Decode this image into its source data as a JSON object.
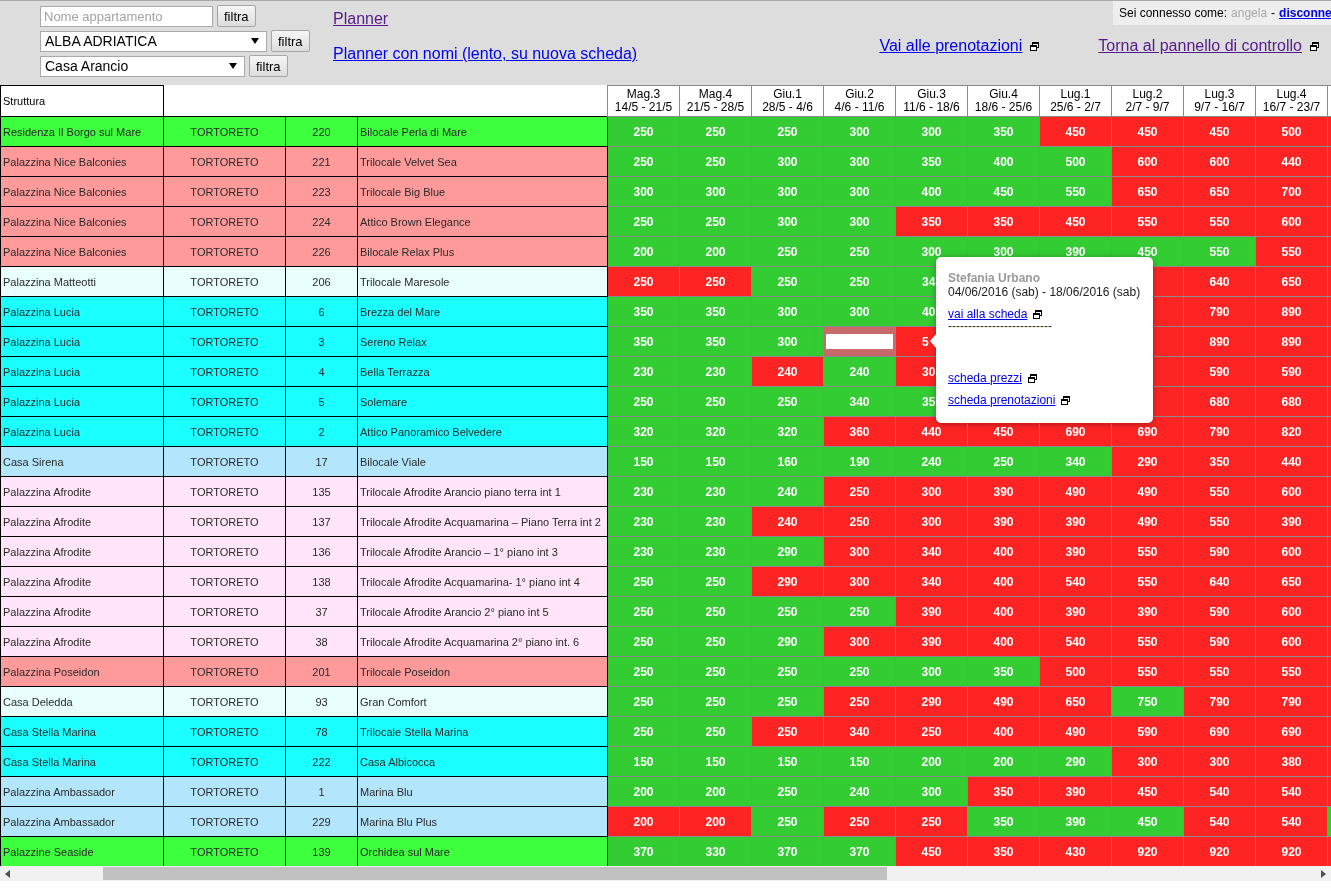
{
  "filters": {
    "search": {
      "placeholder": "Nome appartamento",
      "button": "filtra"
    },
    "selects": [
      {
        "value": "ALBA ADRIATICA",
        "button": "filtra"
      },
      {
        "value": "Casa Arancio",
        "button": "filtra"
      }
    ]
  },
  "planner_links": [
    {
      "label": "Planner",
      "visited": true
    },
    {
      "label": "Planner con nomi (lento, su nuova scheda)",
      "visited": false
    }
  ],
  "user": {
    "label": "Sei connesso come:",
    "name": "angela",
    "separator": "-",
    "logout": "disconne"
  },
  "nav_links": [
    {
      "label": "Vai alle prenotazioni",
      "visited": false
    },
    {
      "label": "Torna al pannello di controllo",
      "visited": true
    }
  ],
  "table": {
    "first_column": "Struttura",
    "weeks": [
      {
        "name": "Mag.3",
        "range": "14/5 - 21/5"
      },
      {
        "name": "Mag.4",
        "range": "21/5 - 28/5"
      },
      {
        "name": "Giu.1",
        "range": "28/5 - 4/6"
      },
      {
        "name": "Giu.2",
        "range": "4/6 - 11/6"
      },
      {
        "name": "Giu.3",
        "range": "11/6 - 18/6"
      },
      {
        "name": "Giu.4",
        "range": "18/6 - 25/6"
      },
      {
        "name": "Lug.1",
        "range": "25/6 - 2/7"
      },
      {
        "name": "Lug.2",
        "range": "2/7 - 9/7"
      },
      {
        "name": "Lug.3",
        "range": "9/7 - 16/7"
      },
      {
        "name": "Lug.4",
        "range": "16/7 - 23/7"
      }
    ],
    "rows": [
      {
        "struttura": "Residenza Il Borgo sul Mare",
        "town": "TORTORETO",
        "number": "220",
        "apartment": "Bilocale Perla di Mare",
        "color": "#3dff3d",
        "cells": [
          {
            "kind": "price",
            "price": "250",
            "booked": false
          },
          {
            "kind": "price",
            "price": "250",
            "booked": false
          },
          {
            "kind": "price",
            "price": "250",
            "booked": false
          },
          {
            "kind": "price",
            "price": "300",
            "booked": false
          },
          {
            "kind": "price",
            "price": "300",
            "booked": false
          },
          {
            "kind": "price",
            "price": "350",
            "booked": false
          },
          {
            "kind": "price",
            "price": "450",
            "booked": true
          },
          {
            "kind": "price",
            "price": "450",
            "booked": true
          },
          {
            "kind": "price",
            "price": "450",
            "booked": true
          },
          {
            "kind": "price",
            "price": "500",
            "booked": true
          },
          {
            "kind": "price",
            "booked": true
          }
        ]
      },
      {
        "struttura": "Palazzina Nice Balconies",
        "town": "TORTORETO",
        "number": "221",
        "apartment": "Trilocale Velvet Sea",
        "color": "#ff9a9a",
        "cells": [
          {
            "kind": "price",
            "price": "250",
            "booked": false
          },
          {
            "kind": "price",
            "price": "250",
            "booked": false
          },
          {
            "kind": "price",
            "price": "300",
            "booked": false
          },
          {
            "kind": "price",
            "price": "300",
            "booked": false
          },
          {
            "kind": "price",
            "price": "350",
            "booked": false
          },
          {
            "kind": "price",
            "price": "400",
            "booked": false
          },
          {
            "kind": "price",
            "price": "500",
            "booked": false
          },
          {
            "kind": "price",
            "price": "600",
            "booked": true
          },
          {
            "kind": "price",
            "price": "600",
            "booked": true
          },
          {
            "kind": "price",
            "price": "440",
            "booked": true
          },
          {
            "kind": "price",
            "booked": true
          }
        ]
      },
      {
        "struttura": "Palazzina Nice Balconies",
        "town": "TORTORETO",
        "number": "223",
        "apartment": "Trilocale Big Blue",
        "color": "#ff9a9a",
        "cells": [
          {
            "kind": "price",
            "price": "300",
            "booked": false
          },
          {
            "kind": "price",
            "price": "300",
            "booked": false
          },
          {
            "kind": "price",
            "price": "300",
            "booked": false
          },
          {
            "kind": "price",
            "price": "300",
            "booked": false
          },
          {
            "kind": "price",
            "price": "400",
            "booked": false
          },
          {
            "kind": "price",
            "price": "450",
            "booked": false
          },
          {
            "kind": "price",
            "price": "550",
            "booked": false
          },
          {
            "kind": "price",
            "price": "650",
            "booked": true
          },
          {
            "kind": "price",
            "price": "650",
            "booked": true
          },
          {
            "kind": "price",
            "price": "700",
            "booked": true
          },
          {
            "kind": "price",
            "booked": true
          }
        ]
      },
      {
        "struttura": "Palazzina Nice Balconies",
        "town": "TORTORETO",
        "number": "224",
        "apartment": "Attico Brown Elegance",
        "color": "#ff9a9a",
        "cells": [
          {
            "kind": "price",
            "price": "250",
            "booked": false
          },
          {
            "kind": "price",
            "price": "250",
            "booked": false
          },
          {
            "kind": "price",
            "price": "300",
            "booked": false
          },
          {
            "kind": "price",
            "price": "300",
            "booked": false
          },
          {
            "kind": "price",
            "price": "350",
            "booked": true
          },
          {
            "kind": "price",
            "price": "350",
            "booked": true
          },
          {
            "kind": "price",
            "price": "450",
            "booked": true
          },
          {
            "kind": "price",
            "price": "550",
            "booked": true
          },
          {
            "kind": "price",
            "price": "550",
            "booked": true
          },
          {
            "kind": "price",
            "price": "600",
            "booked": true
          },
          {
            "kind": "price",
            "booked": true
          }
        ]
      },
      {
        "struttura": "Palazzina Nice Balconies",
        "town": "TORTORETO",
        "number": "226",
        "apartment": "Bilocale Relax Plus",
        "color": "#ff9a9a",
        "cells": [
          {
            "kind": "price",
            "price": "200",
            "booked": false
          },
          {
            "kind": "price",
            "price": "200",
            "booked": false
          },
          {
            "kind": "price",
            "price": "250",
            "booked": false
          },
          {
            "kind": "price",
            "price": "250",
            "booked": false
          },
          {
            "kind": "price",
            "price": "300",
            "booked": false
          },
          {
            "kind": "price",
            "price": "300",
            "booked": false
          },
          {
            "kind": "price",
            "price": "390",
            "booked": false
          },
          {
            "kind": "price",
            "price": "450",
            "booked": false
          },
          {
            "kind": "price",
            "price": "550",
            "booked": false
          },
          {
            "kind": "price",
            "price": "550",
            "booked": true
          },
          {
            "kind": "price",
            "booked": true
          }
        ]
      },
      {
        "struttura": "Palazzina Matteotti",
        "town": "TORTORETO",
        "number": "206",
        "apartment": "Trilocale Maresole",
        "color": "#e8fffe",
        "cells": [
          {
            "kind": "price",
            "price": "250",
            "booked": true
          },
          {
            "kind": "price",
            "price": "250",
            "booked": true
          },
          {
            "kind": "price",
            "price": "250",
            "booked": false
          },
          {
            "kind": "price",
            "price": "250",
            "booked": false
          },
          {
            "kind": "price",
            "price": "34",
            "booked": false
          },
          null,
          null,
          {
            "kind": "price",
            "booked": true
          },
          {
            "kind": "price",
            "price": "640",
            "booked": true
          },
          {
            "kind": "price",
            "price": "650",
            "booked": true
          },
          {
            "kind": "price",
            "booked": true
          }
        ]
      },
      {
        "struttura": "Palazzina Lucia",
        "town": "TORTORETO",
        "number": "6",
        "apartment": "Brezza del Mare",
        "color": "#1affff",
        "cells": [
          {
            "kind": "price",
            "price": "350",
            "booked": false
          },
          {
            "kind": "price",
            "price": "350",
            "booked": false
          },
          {
            "kind": "price",
            "price": "300",
            "booked": false
          },
          {
            "kind": "price",
            "price": "300",
            "booked": false
          },
          {
            "kind": "price",
            "price": "40",
            "booked": false
          },
          null,
          null,
          {
            "kind": "price",
            "booked": true
          },
          {
            "kind": "price",
            "price": "790",
            "booked": true
          },
          {
            "kind": "price",
            "price": "890",
            "booked": true
          },
          {
            "kind": "price",
            "booked": true
          }
        ]
      },
      {
        "struttura": "Palazzina Lucia",
        "town": "TORTORETO",
        "number": "3",
        "apartment": "Sereno Relax",
        "color": "#1affff",
        "cells": [
          {
            "kind": "price",
            "price": "350",
            "booked": false
          },
          {
            "kind": "price",
            "price": "350",
            "booked": false
          },
          {
            "kind": "price",
            "price": "300",
            "booked": false
          },
          {
            "kind": "input",
            "booked": true
          },
          {
            "kind": "price",
            "price": "5",
            "booked": true
          },
          null,
          null,
          {
            "kind": "price",
            "booked": true
          },
          {
            "kind": "price",
            "price": "890",
            "booked": true
          },
          {
            "kind": "price",
            "price": "890",
            "booked": true
          },
          {
            "kind": "price",
            "booked": true
          }
        ]
      },
      {
        "struttura": "Palazzina Lucia",
        "town": "TORTORETO",
        "number": "4",
        "apartment": "Bella Terrazza",
        "color": "#1affff",
        "cells": [
          {
            "kind": "price",
            "price": "230",
            "booked": false
          },
          {
            "kind": "price",
            "price": "230",
            "booked": false
          },
          {
            "kind": "price",
            "price": "240",
            "booked": true
          },
          {
            "kind": "price",
            "price": "240",
            "booked": false
          },
          {
            "kind": "price",
            "price": "30",
            "booked": true
          },
          null,
          null,
          {
            "kind": "price",
            "booked": true
          },
          {
            "kind": "price",
            "price": "590",
            "booked": true
          },
          {
            "kind": "price",
            "price": "590",
            "booked": true
          },
          {
            "kind": "price",
            "booked": true
          }
        ]
      },
      {
        "struttura": "Palazzina Lucia",
        "town": "TORTORETO",
        "number": "5",
        "apartment": "Solemare",
        "color": "#1affff",
        "cells": [
          {
            "kind": "price",
            "price": "250",
            "booked": false
          },
          {
            "kind": "price",
            "price": "250",
            "booked": false
          },
          {
            "kind": "price",
            "price": "250",
            "booked": false
          },
          {
            "kind": "price",
            "price": "340",
            "booked": false
          },
          {
            "kind": "price",
            "price": "35",
            "booked": false
          },
          null,
          null,
          {
            "kind": "price",
            "booked": true
          },
          {
            "kind": "price",
            "price": "680",
            "booked": true
          },
          {
            "kind": "price",
            "price": "680",
            "booked": true
          },
          {
            "kind": "price",
            "booked": true
          }
        ]
      },
      {
        "struttura": "Palazzina Lucia",
        "town": "TORTORETO",
        "number": "2",
        "apartment": "Attico Panoramico Belvedere",
        "color": "#1affff",
        "cells": [
          {
            "kind": "price",
            "price": "320",
            "booked": false
          },
          {
            "kind": "price",
            "price": "320",
            "booked": false
          },
          {
            "kind": "price",
            "price": "320",
            "booked": false
          },
          {
            "kind": "price",
            "price": "360",
            "booked": true
          },
          {
            "kind": "price",
            "price": "440",
            "booked": true
          },
          {
            "kind": "price",
            "price": "450",
            "booked": true
          },
          {
            "kind": "price",
            "price": "690",
            "booked": true
          },
          {
            "kind": "price",
            "price": "690",
            "booked": true
          },
          {
            "kind": "price",
            "price": "790",
            "booked": true
          },
          {
            "kind": "price",
            "price": "820",
            "booked": true
          },
          {
            "kind": "price",
            "booked": true
          }
        ]
      },
      {
        "struttura": "Casa Sirena",
        "town": "TORTORETO",
        "number": "17",
        "apartment": "Bilocale Viale",
        "color": "#b3e5fc",
        "cells": [
          {
            "kind": "price",
            "price": "150",
            "booked": false
          },
          {
            "kind": "price",
            "price": "150",
            "booked": false
          },
          {
            "kind": "price",
            "price": "160",
            "booked": false
          },
          {
            "kind": "price",
            "price": "190",
            "booked": false
          },
          {
            "kind": "price",
            "price": "240",
            "booked": false
          },
          {
            "kind": "price",
            "price": "250",
            "booked": false
          },
          {
            "kind": "price",
            "price": "340",
            "booked": false
          },
          {
            "kind": "price",
            "price": "290",
            "booked": true
          },
          {
            "kind": "price",
            "price": "350",
            "booked": true
          },
          {
            "kind": "price",
            "price": "440",
            "booked": true
          },
          {
            "kind": "price",
            "booked": true
          }
        ]
      },
      {
        "struttura": "Palazzina Afrodite",
        "town": "TORTORETO",
        "number": "135",
        "apartment": "Trilocale Afrodite Arancio piano terra int 1",
        "color": "#ffe4fa",
        "cells": [
          {
            "kind": "price",
            "price": "230",
            "booked": false
          },
          {
            "kind": "price",
            "price": "230",
            "booked": false
          },
          {
            "kind": "price",
            "price": "240",
            "booked": false
          },
          {
            "kind": "price",
            "price": "250",
            "booked": true
          },
          {
            "kind": "price",
            "price": "300",
            "booked": true
          },
          {
            "kind": "price",
            "price": "390",
            "booked": true
          },
          {
            "kind": "price",
            "price": "490",
            "booked": true
          },
          {
            "kind": "price",
            "price": "490",
            "booked": true
          },
          {
            "kind": "price",
            "price": "550",
            "booked": true
          },
          {
            "kind": "price",
            "price": "600",
            "booked": true
          },
          {
            "kind": "price",
            "booked": true
          }
        ]
      },
      {
        "struttura": "Palazzina Afrodite",
        "town": "TORTORETO",
        "number": "137",
        "apartment": "Trilocale Afrodite Acquamarina – Piano Terra int 2",
        "color": "#ffe4fa",
        "cells": [
          {
            "kind": "price",
            "price": "230",
            "booked": false
          },
          {
            "kind": "price",
            "price": "230",
            "booked": false
          },
          {
            "kind": "price",
            "price": "240",
            "booked": true
          },
          {
            "kind": "price",
            "price": "250",
            "booked": true
          },
          {
            "kind": "price",
            "price": "300",
            "booked": true
          },
          {
            "kind": "price",
            "price": "390",
            "booked": true
          },
          {
            "kind": "price",
            "price": "390",
            "booked": true
          },
          {
            "kind": "price",
            "price": "490",
            "booked": true
          },
          {
            "kind": "price",
            "price": "550",
            "booked": true
          },
          {
            "kind": "price",
            "price": "390",
            "booked": true
          },
          {
            "kind": "price",
            "booked": true
          }
        ]
      },
      {
        "struttura": "Palazzina Afrodite",
        "town": "TORTORETO",
        "number": "136",
        "apartment": "Trilocale Afrodite Arancio – 1° piano int 3",
        "color": "#ffe4fa",
        "cells": [
          {
            "kind": "price",
            "price": "230",
            "booked": false
          },
          {
            "kind": "price",
            "price": "230",
            "booked": false
          },
          {
            "kind": "price",
            "price": "290",
            "booked": false
          },
          {
            "kind": "price",
            "price": "300",
            "booked": true
          },
          {
            "kind": "price",
            "price": "340",
            "booked": true
          },
          {
            "kind": "price",
            "price": "400",
            "booked": true
          },
          {
            "kind": "price",
            "price": "390",
            "booked": true
          },
          {
            "kind": "price",
            "price": "550",
            "booked": true
          },
          {
            "kind": "price",
            "price": "590",
            "booked": true
          },
          {
            "kind": "price",
            "price": "600",
            "booked": true
          },
          {
            "kind": "price",
            "booked": true
          }
        ]
      },
      {
        "struttura": "Palazzina Afrodite",
        "town": "TORTORETO",
        "number": "138",
        "apartment": "Trilocale Afrodite Acquamarina- 1° piano int 4",
        "color": "#ffe4fa",
        "cells": [
          {
            "kind": "price",
            "price": "250",
            "booked": false
          },
          {
            "kind": "price",
            "price": "250",
            "booked": false
          },
          {
            "kind": "price",
            "price": "290",
            "booked": true
          },
          {
            "kind": "price",
            "price": "300",
            "booked": true
          },
          {
            "kind": "price",
            "price": "340",
            "booked": true
          },
          {
            "kind": "price",
            "price": "400",
            "booked": true
          },
          {
            "kind": "price",
            "price": "540",
            "booked": true
          },
          {
            "kind": "price",
            "price": "550",
            "booked": true
          },
          {
            "kind": "price",
            "price": "640",
            "booked": true
          },
          {
            "kind": "price",
            "price": "650",
            "booked": true
          },
          {
            "kind": "price",
            "booked": true
          }
        ]
      },
      {
        "struttura": "Palazzina Afrodite",
        "town": "TORTORETO",
        "number": "37",
        "apartment": "Trilocale Afrodite Arancio 2° piano int 5",
        "color": "#ffe4fa",
        "cells": [
          {
            "kind": "price",
            "price": "250",
            "booked": false
          },
          {
            "kind": "price",
            "price": "250",
            "booked": false
          },
          {
            "kind": "price",
            "price": "250",
            "booked": false
          },
          {
            "kind": "price",
            "price": "250",
            "booked": false
          },
          {
            "kind": "price",
            "price": "390",
            "booked": true
          },
          {
            "kind": "price",
            "price": "400",
            "booked": true
          },
          {
            "kind": "price",
            "price": "390",
            "booked": true
          },
          {
            "kind": "price",
            "price": "390",
            "booked": true
          },
          {
            "kind": "price",
            "price": "590",
            "booked": true
          },
          {
            "kind": "price",
            "price": "600",
            "booked": true
          },
          {
            "kind": "price",
            "booked": true
          }
        ]
      },
      {
        "struttura": "Palazzina Afrodite",
        "town": "TORTORETO",
        "number": "38",
        "apartment": "Trilocale Afrodite Acquamarina 2° piano int. 6",
        "color": "#ffe4fa",
        "cells": [
          {
            "kind": "price",
            "price": "250",
            "booked": false
          },
          {
            "kind": "price",
            "price": "250",
            "booked": false
          },
          {
            "kind": "price",
            "price": "290",
            "booked": false
          },
          {
            "kind": "price",
            "price": "300",
            "booked": true
          },
          {
            "kind": "price",
            "price": "390",
            "booked": true
          },
          {
            "kind": "price",
            "price": "400",
            "booked": true
          },
          {
            "kind": "price",
            "price": "540",
            "booked": true
          },
          {
            "kind": "price",
            "price": "550",
            "booked": true
          },
          {
            "kind": "price",
            "price": "590",
            "booked": true
          },
          {
            "kind": "price",
            "price": "600",
            "booked": true
          },
          {
            "kind": "price",
            "booked": true
          }
        ]
      },
      {
        "struttura": "Palazzina Poseidon",
        "town": "TORTORETO",
        "number": "201",
        "apartment": "Trilocale Poseidon",
        "color": "#ff9a9a",
        "cells": [
          {
            "kind": "price",
            "price": "250",
            "booked": false
          },
          {
            "kind": "price",
            "price": "250",
            "booked": false
          },
          {
            "kind": "price",
            "price": "250",
            "booked": false
          },
          {
            "kind": "price",
            "price": "250",
            "booked": false
          },
          {
            "kind": "price",
            "price": "300",
            "booked": false
          },
          {
            "kind": "price",
            "price": "350",
            "booked": false
          },
          {
            "kind": "price",
            "price": "500",
            "booked": true
          },
          {
            "kind": "price",
            "price": "550",
            "booked": true
          },
          {
            "kind": "price",
            "price": "550",
            "booked": true
          },
          {
            "kind": "price",
            "price": "550",
            "booked": true
          },
          {
            "kind": "price",
            "booked": true
          }
        ]
      },
      {
        "struttura": "Casa Deledda",
        "town": "TORTORETO",
        "number": "93",
        "apartment": "Gran Comfort",
        "color": "#e8fffe",
        "cells": [
          {
            "kind": "price",
            "price": "250",
            "booked": false
          },
          {
            "kind": "price",
            "price": "250",
            "booked": false
          },
          {
            "kind": "price",
            "price": "250",
            "booked": false
          },
          {
            "kind": "price",
            "price": "250",
            "booked": true
          },
          {
            "kind": "price",
            "price": "290",
            "booked": true
          },
          {
            "kind": "price",
            "price": "490",
            "booked": true
          },
          {
            "kind": "price",
            "price": "650",
            "booked": true
          },
          {
            "kind": "price",
            "price": "750",
            "booked": false
          },
          {
            "kind": "price",
            "price": "790",
            "booked": true
          },
          {
            "kind": "price",
            "price": "790",
            "booked": true
          },
          {
            "kind": "price",
            "booked": true
          }
        ]
      },
      {
        "struttura": "Casa Stella Marina",
        "town": "TORTORETO",
        "number": "78",
        "apartment": "Trilocale Stella Marina",
        "color": "#1affff",
        "cells": [
          {
            "kind": "price",
            "price": "250",
            "booked": false
          },
          {
            "kind": "price",
            "price": "250",
            "booked": false
          },
          {
            "kind": "price",
            "price": "250",
            "booked": true
          },
          {
            "kind": "price",
            "price": "340",
            "booked": true
          },
          {
            "kind": "price",
            "price": "250",
            "booked": true
          },
          {
            "kind": "price",
            "price": "400",
            "booked": true
          },
          {
            "kind": "price",
            "price": "490",
            "booked": true
          },
          {
            "kind": "price",
            "price": "590",
            "booked": true
          },
          {
            "kind": "price",
            "price": "690",
            "booked": true
          },
          {
            "kind": "price",
            "price": "690",
            "booked": true
          },
          {
            "kind": "price",
            "booked": true
          }
        ]
      },
      {
        "struttura": "Casa Stella Marina",
        "town": "TORTORETO",
        "number": "222",
        "apartment": "Casa Albicocca",
        "color": "#1affff",
        "cells": [
          {
            "kind": "price",
            "price": "150",
            "booked": false
          },
          {
            "kind": "price",
            "price": "150",
            "booked": false
          },
          {
            "kind": "price",
            "price": "150",
            "booked": false
          },
          {
            "kind": "price",
            "price": "150",
            "booked": false
          },
          {
            "kind": "price",
            "price": "200",
            "booked": false
          },
          {
            "kind": "price",
            "price": "200",
            "booked": false
          },
          {
            "kind": "price",
            "price": "290",
            "booked": false
          },
          {
            "kind": "price",
            "price": "300",
            "booked": true
          },
          {
            "kind": "price",
            "price": "300",
            "booked": true
          },
          {
            "kind": "price",
            "price": "380",
            "booked": true
          },
          {
            "kind": "price",
            "booked": true
          }
        ]
      },
      {
        "struttura": "Palazzina Ambassador",
        "town": "TORTORETO",
        "number": "1",
        "apartment": "Marina Blu",
        "color": "#b3e5fc",
        "cells": [
          {
            "kind": "price",
            "price": "200",
            "booked": false
          },
          {
            "kind": "price",
            "price": "200",
            "booked": false
          },
          {
            "kind": "price",
            "price": "250",
            "booked": false
          },
          {
            "kind": "price",
            "price": "240",
            "booked": false
          },
          {
            "kind": "price",
            "price": "300",
            "booked": false
          },
          {
            "kind": "price",
            "price": "350",
            "booked": true
          },
          {
            "kind": "price",
            "price": "390",
            "booked": true
          },
          {
            "kind": "price",
            "price": "450",
            "booked": true
          },
          {
            "kind": "price",
            "price": "540",
            "booked": true
          },
          {
            "kind": "price",
            "price": "540",
            "booked": true
          },
          {
            "kind": "price",
            "booked": true
          }
        ]
      },
      {
        "struttura": "Palazzina Ambassador",
        "town": "TORTORETO",
        "number": "229",
        "apartment": "Marina Blu Plus",
        "color": "#b3e5fc",
        "cells": [
          {
            "kind": "price",
            "price": "200",
            "booked": true
          },
          {
            "kind": "price",
            "price": "200",
            "booked": true
          },
          {
            "kind": "price",
            "price": "250",
            "booked": false
          },
          {
            "kind": "price",
            "price": "250",
            "booked": true
          },
          {
            "kind": "price",
            "price": "250",
            "booked": true
          },
          {
            "kind": "price",
            "price": "350",
            "booked": false
          },
          {
            "kind": "price",
            "price": "390",
            "booked": false
          },
          {
            "kind": "price",
            "price": "450",
            "booked": false
          },
          {
            "kind": "price",
            "price": "540",
            "booked": true
          },
          {
            "kind": "price",
            "price": "540",
            "booked": true
          },
          {
            "kind": "price",
            "booked": false
          }
        ]
      },
      {
        "struttura": "Palazzine Seaside",
        "town": "TORTORETO",
        "number": "139",
        "apartment": "Orchidea sul Mare",
        "color": "#3dff3d",
        "cells": [
          {
            "kind": "price",
            "price": "370",
            "booked": false
          },
          {
            "kind": "price",
            "price": "330",
            "booked": false
          },
          {
            "kind": "price",
            "price": "370",
            "booked": false
          },
          {
            "kind": "price",
            "price": "370",
            "booked": false
          },
          {
            "kind": "price",
            "price": "450",
            "booked": true
          },
          {
            "kind": "price",
            "price": "350",
            "booked": true
          },
          {
            "kind": "price",
            "price": "430",
            "booked": true
          },
          {
            "kind": "price",
            "price": "920",
            "booked": true
          },
          {
            "kind": "price",
            "price": "920",
            "booked": true
          },
          {
            "kind": "price",
            "price": "920",
            "booked": true
          },
          {
            "kind": "price",
            "booked": true
          }
        ]
      }
    ]
  },
  "popup": {
    "guest": "Stefania Urbano",
    "dates": "04/06/2016 (sab) - 18/06/2016 (sab)",
    "record_link": "vai alla scheda",
    "rule": "--------------------------",
    "links": [
      "scheda prezzi",
      "scheda prenotazioni"
    ]
  }
}
